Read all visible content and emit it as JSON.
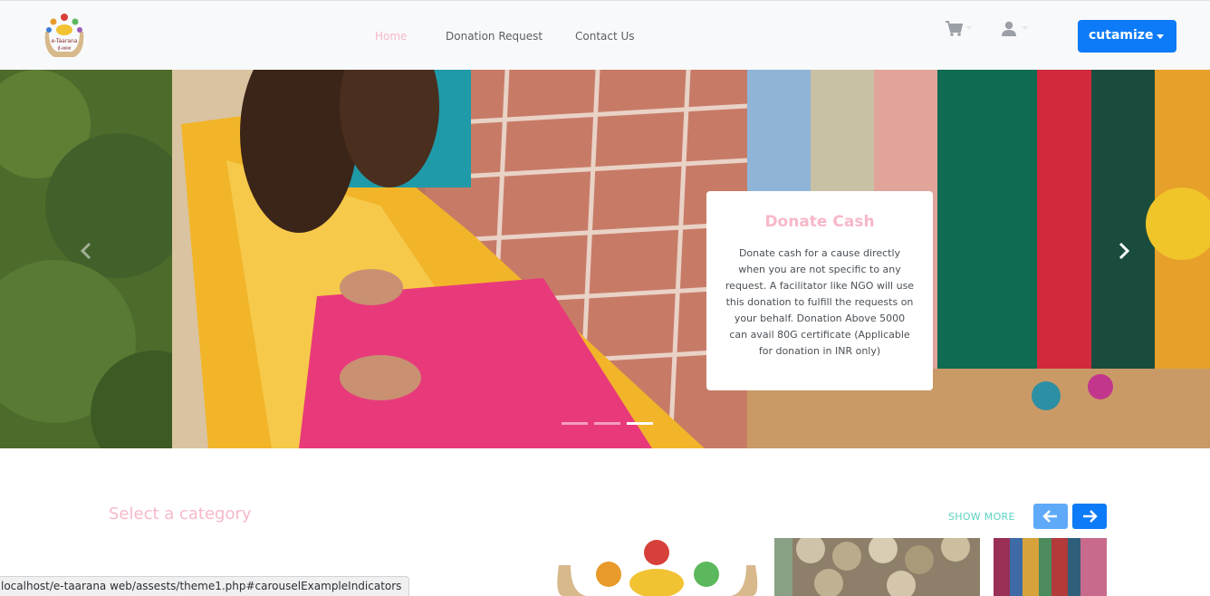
{
  "navbar": {
    "logo_icon": "etaarana-logo",
    "links": [
      {
        "label": "Home",
        "active": true
      },
      {
        "label": "Donation Request",
        "active": false
      },
      {
        "label": "Contact Us",
        "active": false
      }
    ],
    "cart_icon": "shopping-cart-icon",
    "user_icon": "user-icon",
    "customize_label": "cutamize",
    "accent_color": "#0d7bf7",
    "active_link_color": "#f7b8c8"
  },
  "carousel": {
    "prev_icon": "chevron-left-icon",
    "next_icon": "chevron-right-icon",
    "active_slide_index": 2,
    "caption": {
      "title": "Donate Cash",
      "text": "Donate cash for a cause directly when you are not specific to any request. A facilitator like NGO will use this donation to fulfill the requests on your behalf. Donation Above 5000 can avail 80G certificate (Applicable for donation in INR only)"
    }
  },
  "category": {
    "title": "Select a category",
    "show_more_label": "SHOW MORE",
    "prev_icon": "arrow-left-icon",
    "next_icon": "arrow-right-icon"
  },
  "status_bar": {
    "url": "localhost/e-taarana web/assests/theme1.php#carouselExampleIndicators"
  }
}
